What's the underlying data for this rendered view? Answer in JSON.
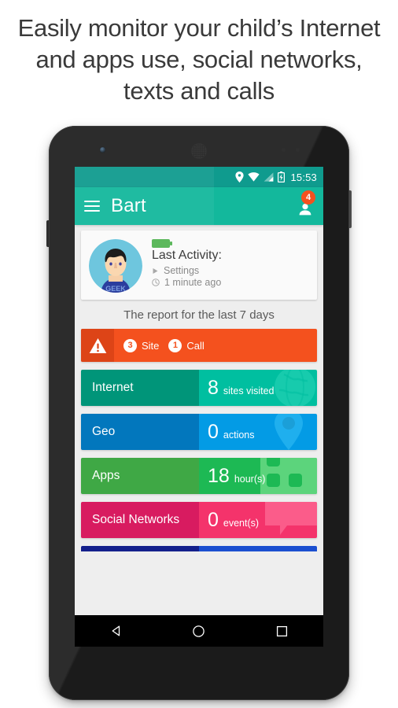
{
  "headline": "Easily monitor your child’s Internet and apps use, social networks, texts and calls",
  "status_bar": {
    "time": "15:53",
    "icons": [
      "location-pin-icon",
      "wifi-icon",
      "signal-icon",
      "battery-charging-icon"
    ]
  },
  "app_bar": {
    "menu_icon": "hamburger-menu-icon",
    "title": "Bart",
    "account_icon": "account-person-icon",
    "badge_count": "4"
  },
  "profile_card": {
    "avatar_alt": "child-avatar",
    "avatar_shirt_text": "GEEK",
    "battery_icon": "battery-full-icon",
    "last_activity_label": "Last Activity:",
    "activity_name": "Settings",
    "activity_icon": "play-triangle-icon",
    "activity_time": "1 minute ago",
    "time_icon": "clock-icon"
  },
  "report": {
    "title": "The report for the last 7 days",
    "alert": {
      "icon": "warning-triangle-icon",
      "items": [
        {
          "count": "3",
          "label": "Site"
        },
        {
          "count": "1",
          "label": "Call"
        }
      ]
    },
    "cards": [
      {
        "name": "Internet",
        "value": "8",
        "unit": "sites visited",
        "left_color": "#009579",
        "right_color": "#00bfa0",
        "watermark": "globe-icon",
        "watermark_color": "#17cbad"
      },
      {
        "name": "Geo",
        "value": "0",
        "unit": "actions",
        "left_color": "#0277bd",
        "right_color": "#039be5",
        "watermark": "map-pin-icon",
        "watermark_color": "#1fafee"
      },
      {
        "name": "Apps",
        "value": "18",
        "unit": "hour(s)",
        "left_color": "#3fa845",
        "right_color": "#1db954",
        "watermark": "apps-grid-icon",
        "watermark_color": "#5cd47c"
      },
      {
        "name": "Social Networks",
        "value": "0",
        "unit": "event(s)",
        "left_color": "#d81b60",
        "right_color": "#f4336b",
        "watermark": "speech-bubble-icon",
        "watermark_color": "#fb5c8a"
      }
    ],
    "next_card_partial": {
      "left_color": "#14208c",
      "right_color": "#1b4fd0"
    }
  },
  "nav_bar": {
    "back": "back-triangle-icon",
    "home": "home-circle-icon",
    "recents": "recents-square-icon"
  },
  "theme": {
    "status_bar_color": "#0f9b8e",
    "app_bar_color": "#13b89c",
    "alert_color": "#f4511e",
    "alert_icon_color": "#dd4417",
    "screen_bg": "#eeeeee"
  }
}
